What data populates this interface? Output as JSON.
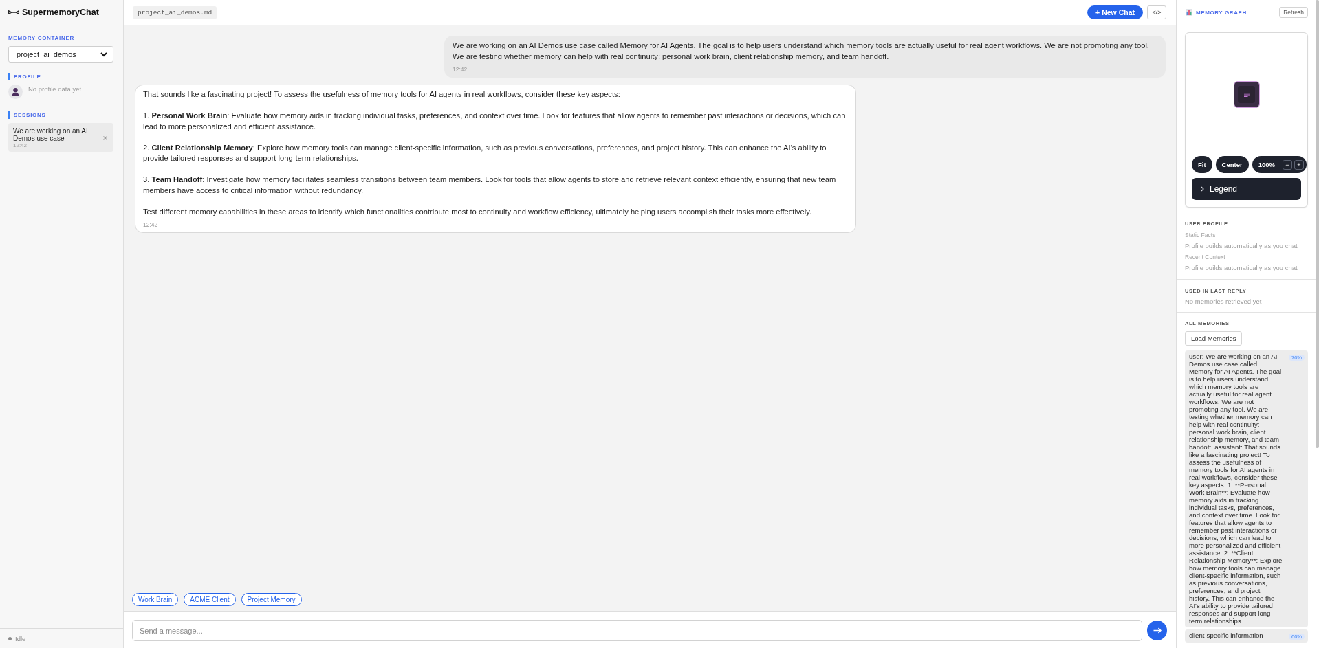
{
  "sidebar": {
    "app_title": "SupermemoryChat",
    "container_label": "MEMORY CONTAINER",
    "container_value": "project_ai_demos",
    "profile_label": "PROFILE",
    "profile_empty": "No profile data yet",
    "sessions_label": "SESSIONS",
    "sessions": [
      {
        "title": "We are working on an AI Demos use case",
        "time": "12:42"
      }
    ],
    "status": "Idle"
  },
  "topbar": {
    "file_name": "project_ai_demos.md",
    "new_chat": "+ New Chat",
    "code_toggle": "</>"
  },
  "messages": [
    {
      "kind": "sent",
      "paragraphs": [
        "We are working on an AI Demos use case called Memory for AI Agents. The goal is to help users understand which memory tools are actually useful for real agent workflows. We are not promoting any tool. We are testing whether memory can help with real continuity: personal work brain, client relationship memory, and team handoff."
      ],
      "time": "12:42"
    },
    {
      "kind": "received",
      "paragraphs": [
        "That sounds like a fascinating project! To assess the usefulness of memory tools for AI agents in real workflows, consider these key aspects:",
        "1. **Personal Work Brain**: Evaluate how memory aids in tracking individual tasks, preferences, and context over time. Look for features that allow agents to remember past interactions or decisions, which can lead to more personalized and efficient assistance.",
        "2. **Client Relationship Memory**: Explore how memory tools can manage client-specific information, such as previous conversations, preferences, and project history. This can enhance the AI's ability to provide tailored responses and support long-term relationships.",
        "3. **Team Handoff**: Investigate how memory facilitates seamless transitions between team members. Look for tools that allow agents to store and retrieve relevant context efficiently, ensuring that new team members have access to critical information without redundancy.",
        "Test different memory capabilities in these areas to identify which functionalities contribute most to continuity and workflow efficiency, ultimately helping users accomplish their tasks more effectively."
      ],
      "time": "12:42"
    }
  ],
  "suggestions": [
    "Work Brain",
    "ACME Client",
    "Project Memory"
  ],
  "composer": {
    "placeholder": "Send a message..."
  },
  "memory_panel": {
    "title": "MEMORY GRAPH",
    "refresh": "Refresh",
    "graph": {
      "fit": "Fit",
      "center": "Center",
      "zoom": "100%",
      "zoom_out": "−",
      "zoom_in": "+",
      "legend": {
        "label": "Legend",
        "expanded": false
      }
    },
    "user_profile": {
      "title": "USER PROFILE",
      "groups": [
        {
          "label": "Static Facts",
          "value": "Profile builds automatically as you chat"
        },
        {
          "label": "Recent Context",
          "value": "Profile builds automatically as you chat"
        }
      ]
    },
    "last_reply": {
      "title": "USED IN LAST REPLY",
      "empty": "No memories retrieved yet"
    },
    "all_memories": {
      "title": "ALL MEMORIES",
      "load": "Load Memories",
      "items": [
        {
          "text": "user: We are working on an AI Demos use case called Memory for AI Agents. The goal is to help users understand which memory tools are actually useful for real agent workflows. We are not promoting any tool. We are testing whether memory can help with real continuity: personal work brain, client relationship memory, and team handoff. assistant: That sounds like a fascinating project! To assess the usefulness of memory tools for AI agents in real workflows, consider these key aspects: 1. **Personal Work Brain**: Evaluate how memory aids in tracking individual tasks, preferences, and context over time. Look for features that allow agents to remember past interactions or decisions, which can lead to more personalized and efficient assistance. 2. **Client Relationship Memory**: Explore how memory tools can manage client-specific information, such as previous conversations, preferences, and project history. This can enhance the AI's ability to provide tailored responses and support long-term relationships.",
          "score": "70%"
        },
        {
          "text": "client-specific information",
          "score": "60%"
        }
      ]
    }
  }
}
